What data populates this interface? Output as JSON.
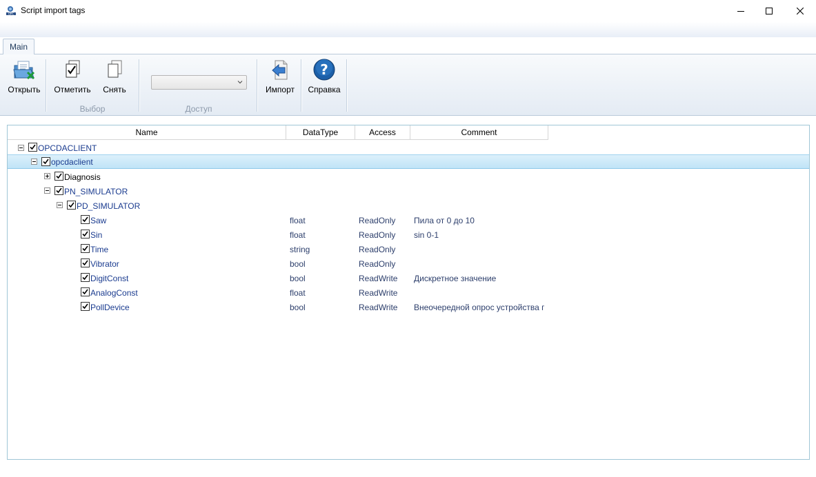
{
  "window": {
    "title": "Script import tags"
  },
  "ribbon": {
    "tab_main": "Main",
    "open_label": "Открыть",
    "mark_label": "Отметить",
    "unmark_label": "Снять",
    "import_label": "Импорт",
    "help_label": "Справка",
    "group_select": "Выбор",
    "group_access": "Доступ",
    "access_select_value": ""
  },
  "columns": [
    "Name",
    "DataType",
    "Access",
    "Comment"
  ],
  "tree": {
    "root": {
      "label": "OPCDACLIENT",
      "checked": true,
      "expanded": true
    },
    "client": {
      "label": "opcdaclient",
      "checked": true,
      "expanded": true
    },
    "diagnosis": {
      "label": "Diagnosis",
      "checked": true,
      "expanded": false
    },
    "pn_sim": {
      "label": "PN_SIMULATOR",
      "checked": true,
      "expanded": true
    },
    "pd_sim": {
      "label": "PD_SIMULATOR",
      "checked": true,
      "expanded": true
    }
  },
  "tags": [
    {
      "name": "Saw",
      "type": "float",
      "access": "ReadOnly",
      "comment": "Пила от 0 до 10"
    },
    {
      "name": "Sin",
      "type": "float",
      "access": "ReadOnly",
      "comment": "sin 0-1"
    },
    {
      "name": "Time",
      "type": "string",
      "access": "ReadOnly",
      "comment": ""
    },
    {
      "name": "Vibrator",
      "type": "bool",
      "access": "ReadOnly",
      "comment": ""
    },
    {
      "name": "DigitConst",
      "type": "bool",
      "access": "ReadWrite",
      "comment": "Дискретное значение"
    },
    {
      "name": "AnalogConst",
      "type": "float",
      "access": "ReadWrite",
      "comment": ""
    },
    {
      "name": "PollDevice",
      "type": "bool",
      "access": "ReadWrite",
      "comment": "Внеочередной опрос устройства г"
    }
  ],
  "colors": {
    "accent": "#1a3b8f",
    "selection": "#c0e4f7",
    "border": "#9fc6d6"
  }
}
